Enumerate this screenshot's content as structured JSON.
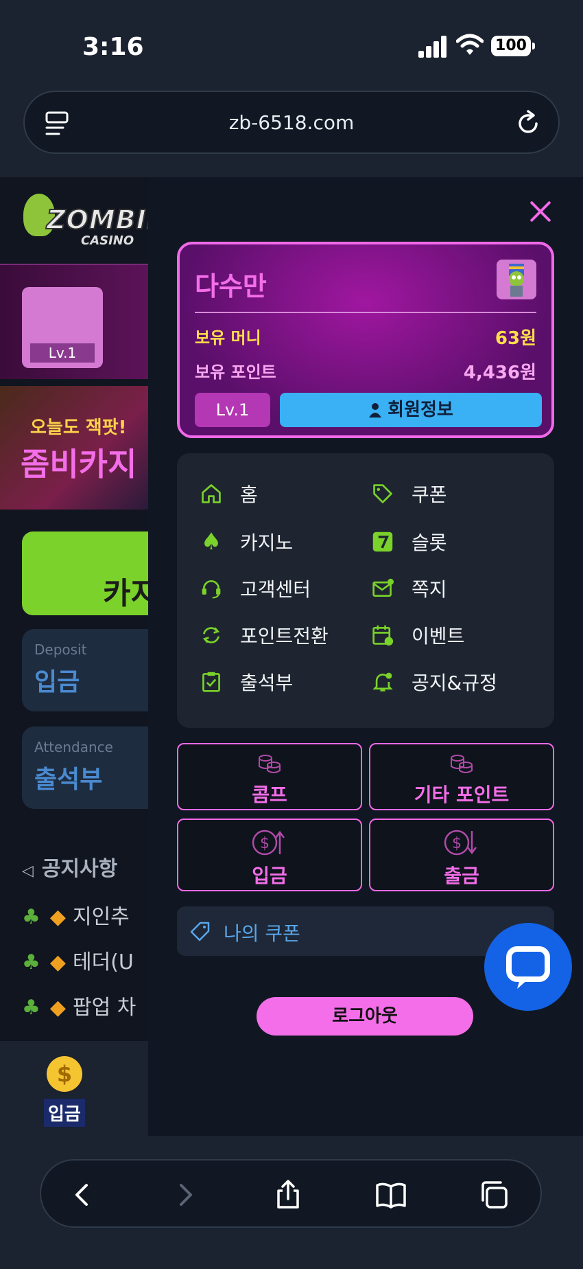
{
  "status_bar": {
    "time": "3:16",
    "battery": "100"
  },
  "url_bar": {
    "url": "zb-6518.com"
  },
  "background_page": {
    "logo_text": "ZOMBIE",
    "logo_sub": "CASINO",
    "level_badge": "Lv.1",
    "banner_line1": "오늘도 잭팟!",
    "banner_line2": "좀비카지",
    "casino_button": "카지",
    "deposit_card": {
      "en": "Deposit",
      "ko": "입금"
    },
    "attendance_card": {
      "en": "Attendance",
      "ko": "출석부"
    },
    "notice_title": "공지사항",
    "notices": [
      "지인추",
      "테더(U",
      "팝업 차"
    ],
    "bottom_deposit_label": "입금"
  },
  "drawer": {
    "user": {
      "name": "다수만",
      "money_label": "보유 머니",
      "money_value": "63원",
      "point_label": "보유 포인트",
      "point_value": "4,436원",
      "level": "Lv.1",
      "member_info_button": "회원정보"
    },
    "menu": [
      {
        "label": "홈",
        "icon": "home-icon"
      },
      {
        "label": "쿠폰",
        "icon": "tag-icon"
      },
      {
        "label": "카지노",
        "icon": "spade-icon"
      },
      {
        "label": "슬롯",
        "icon": "slot-seven-icon"
      },
      {
        "label": "고객센터",
        "icon": "headset-icon"
      },
      {
        "label": "쪽지",
        "icon": "mail-icon"
      },
      {
        "label": "포인트전환",
        "icon": "exchange-icon"
      },
      {
        "label": "이벤트",
        "icon": "calendar-icon"
      },
      {
        "label": "출석부",
        "icon": "clipboard-check-icon"
      },
      {
        "label": "공지&규정",
        "icon": "bell-icon"
      }
    ],
    "actions": {
      "comp": "콤프",
      "other_points": "기타 포인트",
      "deposit": "입금",
      "withdraw": "출금"
    },
    "my_coupon": "나의 쿠폰",
    "logout": "로그아웃"
  },
  "colors": {
    "accent_pink": "#f06ae8",
    "accent_green": "#7ad22a",
    "accent_blue": "#3ab0f5",
    "money_yellow": "#ffde4a"
  }
}
